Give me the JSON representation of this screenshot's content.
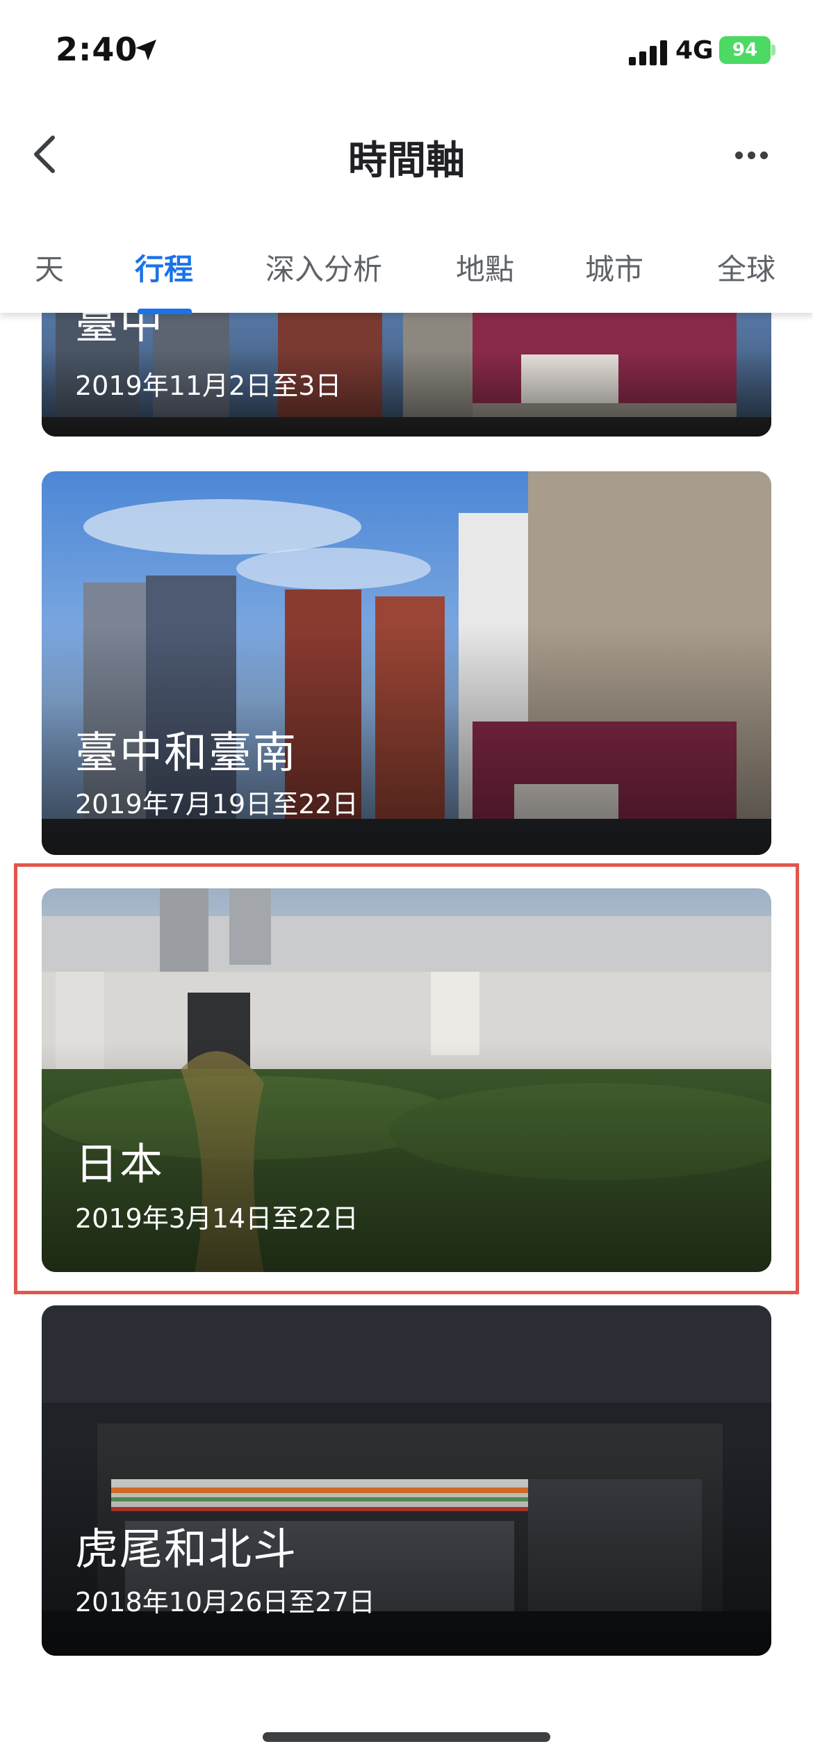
{
  "status_bar": {
    "time": "2:40",
    "network": "4G",
    "battery": "94"
  },
  "header": {
    "title": "時間軸"
  },
  "tabs": [
    {
      "label": "天"
    },
    {
      "label": "行程",
      "active": true
    },
    {
      "label": "深入分析"
    },
    {
      "label": "地點"
    },
    {
      "label": "城市"
    },
    {
      "label": "全球"
    }
  ],
  "trips": [
    {
      "name": "臺中",
      "dates": "2019年11月2日至3日"
    },
    {
      "name": "臺中和臺南",
      "dates": "2019年7月19日至22日"
    },
    {
      "name": "日本",
      "dates": "2019年3月14日至22日",
      "highlighted": true
    },
    {
      "name": "虎尾和北斗",
      "dates": "2018年10月26日至27日"
    }
  ],
  "colors": {
    "accent": "#1a73e8",
    "highlight": "#e0574e"
  }
}
